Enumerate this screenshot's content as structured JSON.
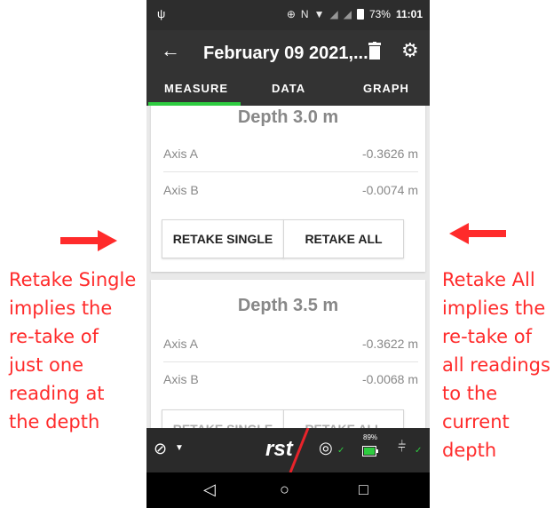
{
  "status_bar": {
    "battery": "73%",
    "time": "11:01"
  },
  "app_bar": {
    "title": "February 09 2021,..."
  },
  "tabs": [
    {
      "label": "MEASURE"
    },
    {
      "label": "DATA"
    },
    {
      "label": "GRAPH"
    }
  ],
  "cards": [
    {
      "depth": "Depth 3.0 m",
      "rows": [
        {
          "label": "Axis A",
          "value": "-0.3626 m"
        },
        {
          "label": "Axis B",
          "value": "-0.0074 m"
        }
      ],
      "retake_single": "RETAKE SINGLE",
      "retake_all": "RETAKE ALL"
    },
    {
      "depth": "Depth 3.5 m",
      "rows": [
        {
          "label": "Axis A",
          "value": "-0.3622 m"
        },
        {
          "label": "Axis B",
          "value": "-0.0068 m"
        }
      ],
      "retake_single": "RETAKE SINGLE",
      "retake_all": "RETAKE ALL"
    }
  ],
  "bottom_bar": {
    "logo": "rst",
    "battery_level": "89%"
  },
  "annotations": {
    "left_lines": [
      "Retake Single",
      "implies the",
      "re-take of",
      "just one",
      "reading at",
      "the depth"
    ],
    "right_lines": [
      "Retake All",
      "implies the",
      "re-take of",
      "all readings",
      "to the",
      "current",
      "depth"
    ],
    "color": "#ff2b2b"
  },
  "colors": {
    "tab_indicator": "#2ecc40",
    "appbar": "#333333",
    "accent_check": "#2ecc40"
  }
}
